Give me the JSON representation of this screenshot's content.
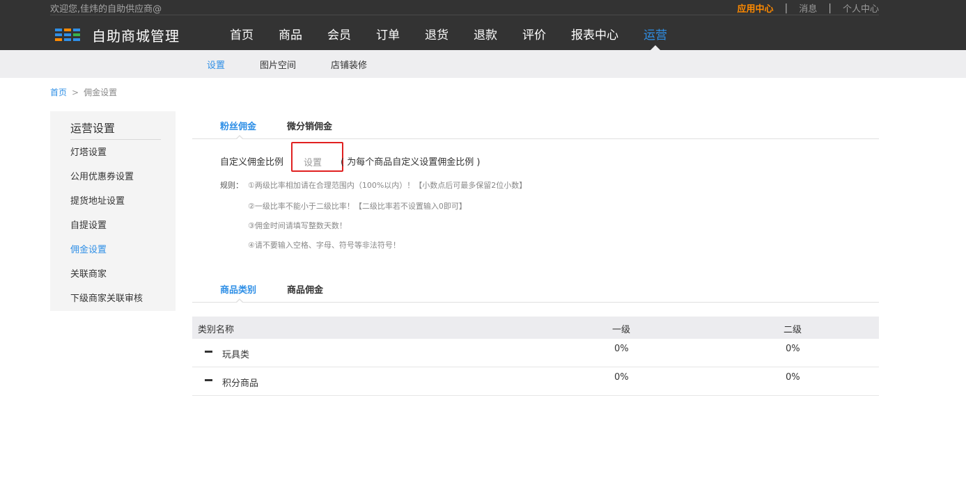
{
  "header": {
    "welcome": "欢迎您,佳炜的自助供应商@",
    "links": [
      "应用中心",
      "消息",
      "个人中心"
    ],
    "separator": "|",
    "logo_title": "自助商城管理",
    "nav": [
      "首页",
      "商品",
      "会员",
      "订单",
      "退货",
      "退款",
      "评价",
      "报表中心",
      "运营"
    ],
    "active_nav": "运营"
  },
  "subnav": {
    "items": [
      "设置",
      "图片空间",
      "店铺装修"
    ],
    "active": "设置"
  },
  "breadcrumb": {
    "home": "首页",
    "arrow": ">",
    "current": "佣金设置"
  },
  "sidebar": {
    "title": "运营设置",
    "items": [
      "灯塔设置",
      "公用优惠券设置",
      "提货地址设置",
      "自提设置",
      "佣金设置",
      "关联商家",
      "下级商家关联审核"
    ],
    "active": "佣金设置"
  },
  "commission_tabs": {
    "items": [
      "粉丝佣金",
      "微分销佣金"
    ],
    "active": "粉丝佣金"
  },
  "custom": {
    "label": "自定义佣金比例",
    "button": "设置",
    "hint": "( 为每个商品自定义设置佣金比例 )"
  },
  "rules": {
    "label": "规则：",
    "lines": [
      "①两级比率相加请在合理范围内（100%以内）！【小数点后可最多保留2位小数】",
      "②一级比率不能小于二级比率！【二级比率若不设置输入0即可】",
      "③佣金时间请填写整数天数！",
      "④请不要输入空格、字母、符号等非法符号！"
    ]
  },
  "category_tabs": {
    "items": [
      "商品类别",
      "商品佣金"
    ],
    "active": "商品类别"
  },
  "table": {
    "headers": [
      "类别名称",
      "一级",
      "二级"
    ],
    "rows": [
      {
        "name": "玩具类",
        "level1": "0%",
        "level2": "0%"
      },
      {
        "name": "积分商品",
        "level1": "0%",
        "level2": "0%"
      }
    ]
  },
  "colors": {
    "accent": "#2f8fe6",
    "app_center": "#ff8a00",
    "highlight_box": "#e02020",
    "header_bg": "#333333"
  }
}
